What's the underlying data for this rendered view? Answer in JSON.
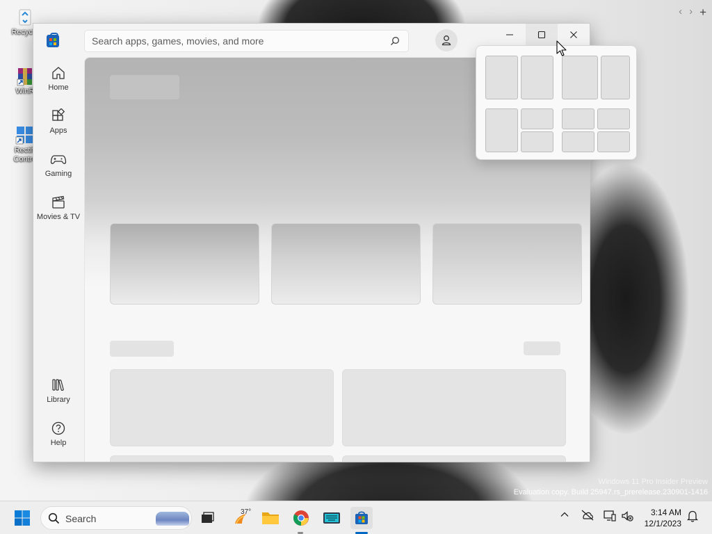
{
  "desktop": {
    "icons": [
      {
        "label": "Recycle",
        "icon": "recycle-bin-icon"
      },
      {
        "label": "WinR",
        "icon": "winrar-icon"
      },
      {
        "label": "Rectifi\nContro",
        "icon": "shortcut-app-icon"
      }
    ],
    "browser_nav": {
      "back": "‹",
      "forward": "›",
      "new_tab": "+"
    },
    "watermark": {
      "line1": "Windows 11 Pro Insider Preview",
      "line2": "Evaluation copy. Build 25947.rs_prerelease.230901-1416"
    }
  },
  "store": {
    "search": {
      "placeholder": "Search apps, games, movies, and more",
      "value": ""
    },
    "nav": [
      {
        "label": "Home",
        "icon": "home-icon"
      },
      {
        "label": "Apps",
        "icon": "apps-icon"
      },
      {
        "label": "Gaming",
        "icon": "gamepad-icon"
      },
      {
        "label": "Movies & TV",
        "icon": "clapperboard-icon"
      }
    ],
    "nav_bottom": [
      {
        "label": "Library",
        "icon": "library-icon"
      },
      {
        "label": "Help",
        "icon": "help-icon"
      }
    ],
    "window_controls": {
      "minimize": "minimize-icon",
      "maximize": "maximize-icon",
      "close": "close-icon"
    },
    "content_state": "loading-skeleton"
  },
  "snap_layouts": {
    "layouts": [
      "two-columns-equal",
      "two-columns-wide-right",
      "one-plus-two-right",
      "four-quadrants"
    ]
  },
  "taskbar": {
    "search_label": "Search",
    "weather_temp": "37°",
    "pinned": [
      {
        "name": "task-view",
        "icon": "task-view-icon"
      },
      {
        "name": "weather",
        "icon": "weather-icon"
      },
      {
        "name": "file-explorer",
        "icon": "folder-icon"
      },
      {
        "name": "chrome",
        "icon": "chrome-icon"
      },
      {
        "name": "keyboard-app",
        "icon": "keyboard-icon"
      },
      {
        "name": "microsoft-store",
        "icon": "store-icon",
        "active": true
      }
    ],
    "tray": {
      "chevron": "chevron-up-icon",
      "icons": [
        "cloud-offline-icon",
        "network-icon",
        "volume-muted-icon",
        "notification-bell-icon"
      ]
    },
    "time": "3:14 AM",
    "date": "12/1/2023"
  },
  "colors": {
    "accent": "#0067c0",
    "store_blue": "#1a63b8",
    "taskbar_bg": "#eeeeee"
  }
}
